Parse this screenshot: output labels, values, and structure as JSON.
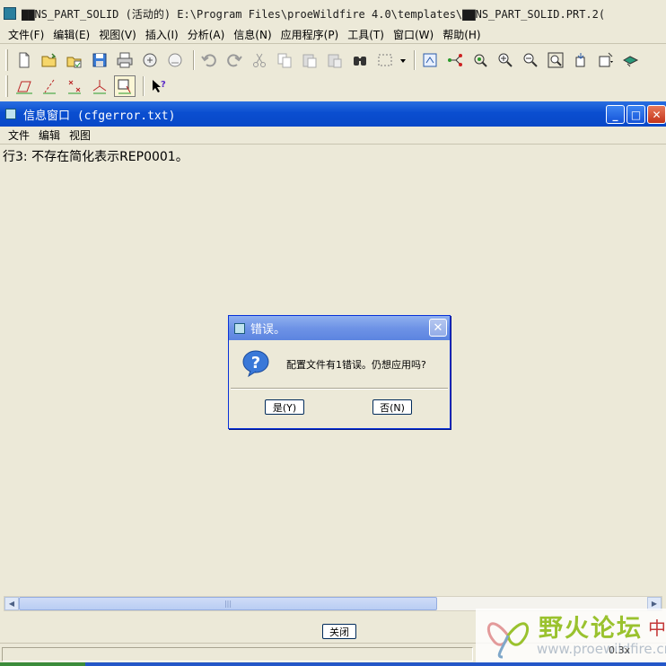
{
  "main_window": {
    "title": "▇▇NS_PART_SOLID (活动的) E:\\Program Files\\proeWildfire 4.0\\templates\\▇▇NS_PART_SOLID.PRT.2("
  },
  "main_menu": [
    "文件(F)",
    "编辑(E)",
    "视图(V)",
    "插入(I)",
    "分析(A)",
    "信息(N)",
    "应用程序(P)",
    "工具(T)",
    "窗口(W)",
    "帮助(H)"
  ],
  "toolbar_row1_icons": [
    "new-file-icon",
    "open-folder-icon",
    "open-session-icon",
    "save-icon",
    "print-icon",
    "send-mail-icon",
    "mail-attach-icon",
    "undo-icon",
    "redo-icon",
    "cut-icon",
    "copy-icon",
    "paste-icon",
    "paste-special-icon",
    "find-binoculars-icon",
    "select-box-icon",
    "dropdown-arrow-icon",
    "repaint-icon",
    "datum-axis-icon",
    "spin-center-icon",
    "zoom-in-icon",
    "zoom-out-icon",
    "refit-icon",
    "reorient-icon",
    "saved-views-icon",
    "layers-icon"
  ],
  "toolbar_row2_icons": [
    "plane-display-icon",
    "axis-display-icon",
    "point-display-icon",
    "csys-display-icon",
    "annotation-display-icon",
    "context-help-icon"
  ],
  "info_window": {
    "title": "信息窗口 (cfgerror.txt)",
    "menu": [
      "文件",
      "编辑",
      "视图"
    ],
    "content_line": "行3: 不存在简化表示REP0001。",
    "close_label": "关闭"
  },
  "dialog": {
    "title": "错误。",
    "message": "配置文件有1错误。仍想应用吗?",
    "yes_label": "是(Y)",
    "no_label": "否(N)"
  },
  "watermark": {
    "title": "野火论坛",
    "url": "www.proewildfire.cn",
    "edge_char": "中",
    "zoom": "0.3x"
  }
}
